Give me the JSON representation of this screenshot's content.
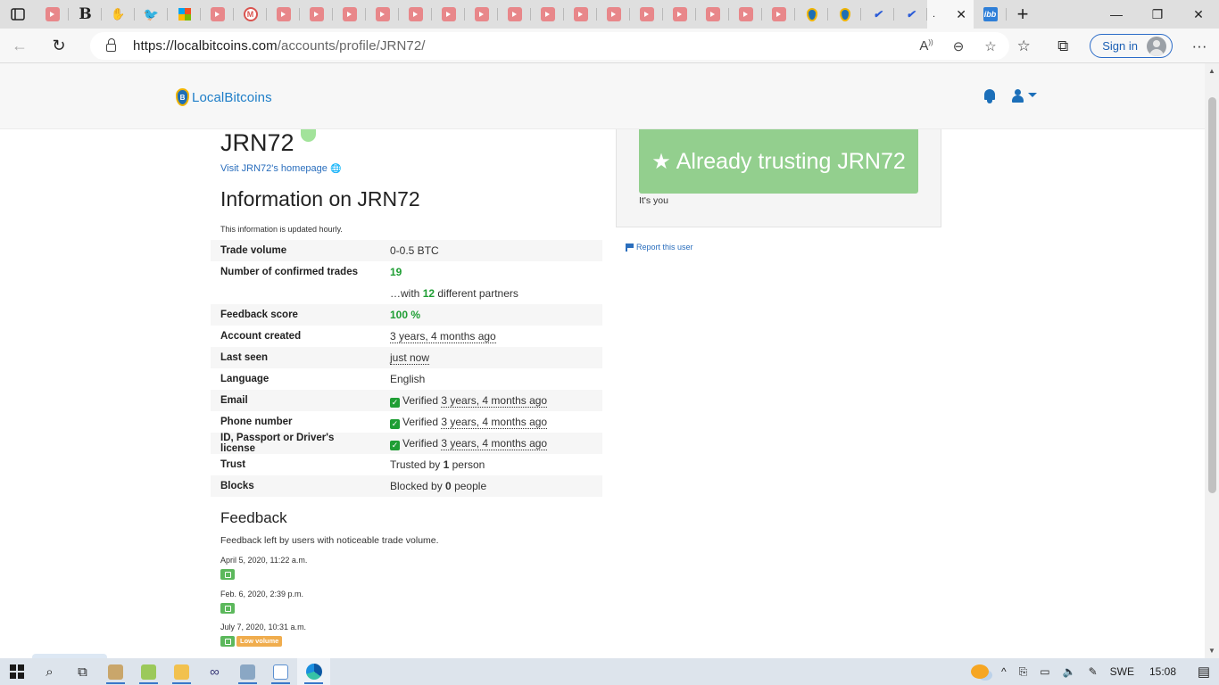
{
  "browser": {
    "url_host": "https://localbitcoins.com",
    "url_path": "/accounts/profile/JRN72/",
    "active_tab_label": ".",
    "signin_label": "Sign in"
  },
  "site": {
    "brand": "LocalBitcoins",
    "brand_mark": "B"
  },
  "profile": {
    "username": "JRN72",
    "homepage_link": "Visit JRN72's homepage",
    "info_heading": "Information on JRN72",
    "updated_note": "This information is updated hourly.",
    "rows": {
      "trade_volume": {
        "label": "Trade volume",
        "value": "0-0.5 BTC"
      },
      "confirmed_trades": {
        "label": "Number of confirmed trades",
        "value": "19"
      },
      "partners": {
        "prefix": "…with",
        "count": "12",
        "suffix": "different partners"
      },
      "feedback_score": {
        "label": "Feedback score",
        "value": "100 %"
      },
      "account_created": {
        "label": "Account created",
        "value": "3 years, 4 months ago"
      },
      "last_seen": {
        "label": "Last seen",
        "value": "just now"
      },
      "language": {
        "label": "Language",
        "value": "English"
      },
      "email": {
        "label": "Email",
        "status": "Verified",
        "when": "3 years, 4 months ago"
      },
      "phone": {
        "label": "Phone number",
        "status": "Verified",
        "when": "3 years, 4 months ago"
      },
      "id": {
        "label": "ID, Passport or Driver's license",
        "status": "Verified",
        "when": "3 years, 4 months ago"
      },
      "trust": {
        "label": "Trust",
        "prefix": "Trusted by",
        "count": "1",
        "suffix": "person"
      },
      "blocks": {
        "label": "Blocks",
        "prefix": "Blocked by",
        "count": "0",
        "suffix": "people"
      }
    }
  },
  "feedback": {
    "heading": "Feedback",
    "note": "Feedback left by users with noticeable trade volume.",
    "items": [
      {
        "date": "April 5, 2020, 11:22 a.m."
      },
      {
        "date": "Feb. 6, 2020, 2:39 p.m."
      },
      {
        "date": "July 7, 2020, 10:31 a.m.",
        "badge": "Low volume"
      }
    ]
  },
  "trust_panel": {
    "button_label": "Already trusting JRN72",
    "note": "It's you",
    "report_label": "Report this user"
  },
  "taskbar": {
    "language": "SWE",
    "time": "15:08"
  }
}
